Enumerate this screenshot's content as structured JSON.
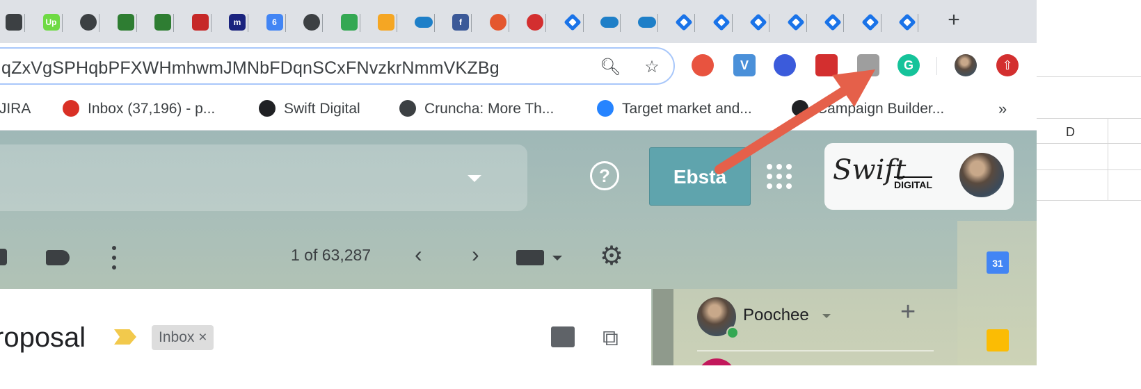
{
  "browser": {
    "new_tab_label": "+",
    "address_bar": {
      "url": "qZxVgSPHqbPFXWHmhwmJMNbFDqnSCxFNvzkrNmmVKZBg",
      "zoom_icon": "zoom-icon",
      "bookmark_icon": "star-icon"
    },
    "tabs": [
      {
        "icon": "zendesk-icon",
        "color": "#3c4043"
      },
      {
        "icon": "upwork-icon",
        "color": "#6fda44",
        "glyph": "Up"
      },
      {
        "icon": "globe-icon",
        "color": "#3c4043"
      },
      {
        "icon": "flag-icon",
        "color": "#2e7d32"
      },
      {
        "icon": "flag-icon",
        "color": "#2e7d32"
      },
      {
        "icon": "briefcase-icon",
        "color": "#c62828"
      },
      {
        "icon": "m-icon",
        "color": "#1a237e",
        "glyph": "m"
      },
      {
        "icon": "calendar-icon",
        "color": "#4285f4",
        "glyph": "6"
      },
      {
        "icon": "globe-icon",
        "color": "#3c4043"
      },
      {
        "icon": "maps-icon",
        "color": "#34a853"
      },
      {
        "icon": "kite-icon",
        "color": "#f5a623"
      },
      {
        "icon": "salesforce-icon",
        "color": "#1e7fc8"
      },
      {
        "icon": "facebook-icon",
        "color": "#3b5998",
        "glyph": "f"
      },
      {
        "icon": "wheel-icon",
        "color": "#e4572e"
      },
      {
        "icon": "home-icon",
        "color": "#d32f2f"
      },
      {
        "icon": "diamond-icon",
        "color": "#1a73e8"
      },
      {
        "icon": "salesforce-icon",
        "color": "#1e7fc8"
      },
      {
        "icon": "salesforce-icon",
        "color": "#1e7fc8"
      },
      {
        "icon": "diamond-icon",
        "color": "#1a73e8"
      },
      {
        "icon": "diamond-icon",
        "color": "#1a73e8"
      },
      {
        "icon": "diamond-icon",
        "color": "#1a73e8"
      },
      {
        "icon": "diamond-icon",
        "color": "#1a73e8"
      },
      {
        "icon": "diamond-icon",
        "color": "#1a73e8"
      },
      {
        "icon": "diamond-icon",
        "color": "#1a73e8"
      },
      {
        "icon": "diamond-icon",
        "color": "#1a73e8"
      }
    ],
    "extensions": [
      {
        "icon": "ebsta-extension-icon",
        "color": "#e8533f"
      },
      {
        "icon": "v-extension-icon",
        "color": "#4a90d9",
        "glyph": "V"
      },
      {
        "icon": "rocket-extension-icon",
        "color": "#3b5bdb"
      },
      {
        "icon": "calendar-extension-icon",
        "color": "#d32f2f"
      },
      {
        "icon": "page-extension-icon",
        "color": "#9e9e9e"
      },
      {
        "icon": "grammarly-extension-icon",
        "color": "#15c39a",
        "glyph": "G"
      }
    ],
    "profile_icon": "profile-avatar-icon",
    "update_icon": "update-icon",
    "bookmarks": [
      {
        "label": "- JIRA",
        "icon": "jira-icon"
      },
      {
        "label": "Inbox (37,196) - p...",
        "icon": "gmail-icon",
        "color": "#d93025"
      },
      {
        "label": "Swift Digital",
        "icon": "paper-plane-icon",
        "color": "#202124"
      },
      {
        "label": "Cruncha: More Th...",
        "icon": "globe-icon",
        "color": "#3c4043"
      },
      {
        "label": "Target market and...",
        "icon": "confluence-icon",
        "color": "#2684ff"
      },
      {
        "label": "Campaign Builder...",
        "icon": "paper-plane-icon",
        "color": "#202124"
      }
    ],
    "bookmarks_overflow": "»"
  },
  "gmail": {
    "help_label": "?",
    "ebsta_button": "Ebsta",
    "brand": {
      "signature": "Swift",
      "wordmark": "DIGITAL"
    },
    "pagination": "1 of 63,287",
    "prev_label": "‹",
    "next_label": "›",
    "settings_glyph": "⚙",
    "subject": "roposal",
    "inbox_chip": "Inbox ×",
    "popout_glyph": "⧉",
    "contact": {
      "name": "Poochee",
      "add_label": "+"
    },
    "calendar_day": "31"
  },
  "background_window": {
    "column_header": "D"
  },
  "annotation": {
    "arrow_color": "#e5604a",
    "points_to": "page-extension-icon"
  }
}
